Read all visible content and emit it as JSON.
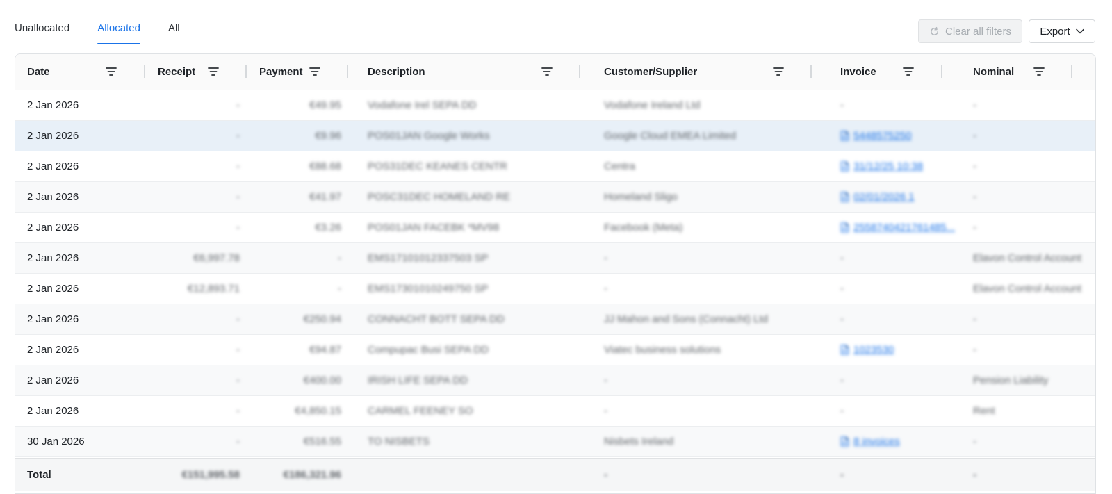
{
  "tabs": [
    {
      "label": "Unallocated"
    },
    {
      "label": "Allocated"
    },
    {
      "label": "All"
    }
  ],
  "active_tab": "Allocated",
  "toolbar": {
    "clear_label": "Clear all filters",
    "export_label": "Export"
  },
  "columns": [
    "Date",
    "Receipt",
    "Payment",
    "Description",
    "Customer/Supplier",
    "Invoice",
    "Nominal"
  ],
  "rows": [
    {
      "date": "2 Jan 2026",
      "receipt": "-",
      "payment": "€49.95",
      "description": "Vodafone Irel SEPA DD",
      "customer": "Vodafone Ireland Ltd",
      "invoice": "-",
      "nominal": "-"
    },
    {
      "date": "2 Jan 2026",
      "receipt": "-",
      "payment": "€9.96",
      "description": "POS01JAN Google Works",
      "customer": "Google Cloud EMEA Limited",
      "invoice": "5448575250",
      "nominal": "-"
    },
    {
      "date": "2 Jan 2026",
      "receipt": "-",
      "payment": "€88.68",
      "description": "POS31DEC KEANES CENTR",
      "customer": "Centra",
      "invoice": "31/12/25 10:38",
      "nominal": "-"
    },
    {
      "date": "2 Jan 2026",
      "receipt": "-",
      "payment": "€41.97",
      "description": "POSC31DEC HOMELAND RE",
      "customer": "Homeland Sligo",
      "invoice": "02/01/2026 1",
      "nominal": "-"
    },
    {
      "date": "2 Jan 2026",
      "receipt": "-",
      "payment": "€3.26",
      "description": "POS01JAN FACEBK *MV98",
      "customer": "Facebook (Meta)",
      "invoice": "2558740421761485...",
      "nominal": "-"
    },
    {
      "date": "2 Jan 2026",
      "receipt": "€6,997.78",
      "payment": "-",
      "description": "EMS17101012337503 SP",
      "customer": "-",
      "invoice": "-",
      "nominal": "Elavon Control Account"
    },
    {
      "date": "2 Jan 2026",
      "receipt": "€12,893.71",
      "payment": "-",
      "description": "EMS17301010249750 SP",
      "customer": "-",
      "invoice": "-",
      "nominal": "Elavon Control Account"
    },
    {
      "date": "2 Jan 2026",
      "receipt": "-",
      "payment": "€250.94",
      "description": "CONNACHT BOTT SEPA DD",
      "customer": "JJ Mahon and Sons (Connacht) Ltd",
      "invoice": "-",
      "nominal": "-"
    },
    {
      "date": "2 Jan 2026",
      "receipt": "-",
      "payment": "€94.87",
      "description": "Compupac Busi SEPA DD",
      "customer": "Viatec business solutions",
      "invoice": "1023530",
      "nominal": "-"
    },
    {
      "date": "2 Jan 2026",
      "receipt": "-",
      "payment": "€400.00",
      "description": "IRISH LIFE SEPA DD",
      "customer": "-",
      "invoice": "-",
      "nominal": "Pension Liability"
    },
    {
      "date": "2 Jan 2026",
      "receipt": "-",
      "payment": "€4,850.15",
      "description": "CARMEL FEENEY SO",
      "customer": "-",
      "invoice": "-",
      "nominal": "Rent"
    },
    {
      "date": "30 Jan 2026",
      "receipt": "-",
      "payment": "€516.55",
      "description": "TO NISBETS",
      "customer": "Nisbets Ireland",
      "invoice": "8 invoices",
      "nominal": "-"
    }
  ],
  "total": {
    "label": "Total",
    "receipt": "€151,995.58",
    "payment": "€186,321.96",
    "customer": "-",
    "invoice": "-",
    "nominal": "-"
  },
  "colors": {
    "accent": "#1a73e8",
    "highlight_row": "#e8f0f8"
  }
}
